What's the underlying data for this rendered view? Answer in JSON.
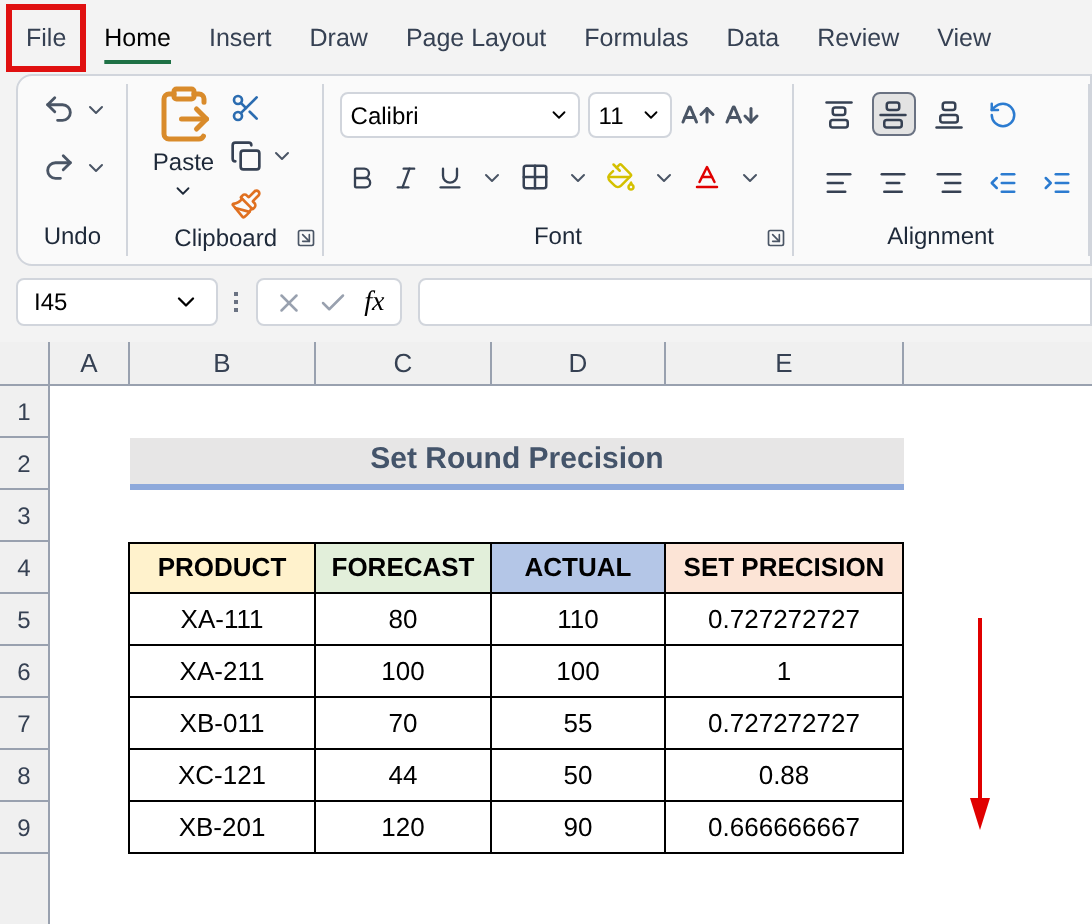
{
  "menu_tabs": [
    {
      "label": "File",
      "selected": false,
      "outlined": true
    },
    {
      "label": "Home",
      "selected": true,
      "outlined": false
    },
    {
      "label": "Insert",
      "selected": false,
      "outlined": false
    },
    {
      "label": "Draw",
      "selected": false,
      "outlined": false
    },
    {
      "label": "Page Layout",
      "selected": false,
      "outlined": false
    },
    {
      "label": "Formulas",
      "selected": false,
      "outlined": false
    },
    {
      "label": "Data",
      "selected": false,
      "outlined": false
    },
    {
      "label": "Review",
      "selected": false,
      "outlined": false
    },
    {
      "label": "View",
      "selected": false,
      "outlined": false
    }
  ],
  "ribbon": {
    "paste_label": "Paste",
    "font_name": "Calibri",
    "font_size": "11",
    "groups": [
      {
        "label": "Undo",
        "launcher": false
      },
      {
        "label": "Clipboard",
        "launcher": true
      },
      {
        "label": "Font",
        "launcher": true
      },
      {
        "label": "Alignment",
        "launcher": false
      }
    ],
    "align_buttons": [
      {
        "kind": "top",
        "selected": false
      },
      {
        "kind": "middle",
        "selected": true
      },
      {
        "kind": "bottom",
        "selected": false
      },
      {
        "kind": "orientation",
        "selected": false
      },
      {
        "kind": "left",
        "selected": false
      },
      {
        "kind": "center",
        "selected": false
      },
      {
        "kind": "right",
        "selected": false
      },
      {
        "kind": "outdent",
        "selected": false
      },
      {
        "kind": "indent",
        "selected": false
      }
    ]
  },
  "formula_bar": {
    "name_box": "I45",
    "function_label": "fx"
  },
  "sheet": {
    "columns": [
      "A",
      "B",
      "C",
      "D",
      "E"
    ],
    "rows": [
      "1",
      "2",
      "3",
      "4",
      "5",
      "6",
      "7",
      "8",
      "9"
    ],
    "title": "Set Round Precision",
    "table": {
      "columns": [
        {
          "label": "PRODUCT",
          "color": "#fff2cc"
        },
        {
          "label": "FORECAST",
          "color": "#e2efda"
        },
        {
          "label": "ACTUAL",
          "color": "#b4c6e7"
        },
        {
          "label": "SET PRECISION",
          "color": "#fce4d6"
        }
      ],
      "rows": [
        [
          "XA-111",
          "80",
          "110",
          "0.727272727"
        ],
        [
          "XA-211",
          "100",
          "100",
          "1"
        ],
        [
          "XB-011",
          "70",
          "55",
          "0.727272727"
        ],
        [
          "XC-121",
          "44",
          "50",
          "0.88"
        ],
        [
          "XB-201",
          "120",
          "90",
          "0.666666667"
        ]
      ]
    }
  }
}
